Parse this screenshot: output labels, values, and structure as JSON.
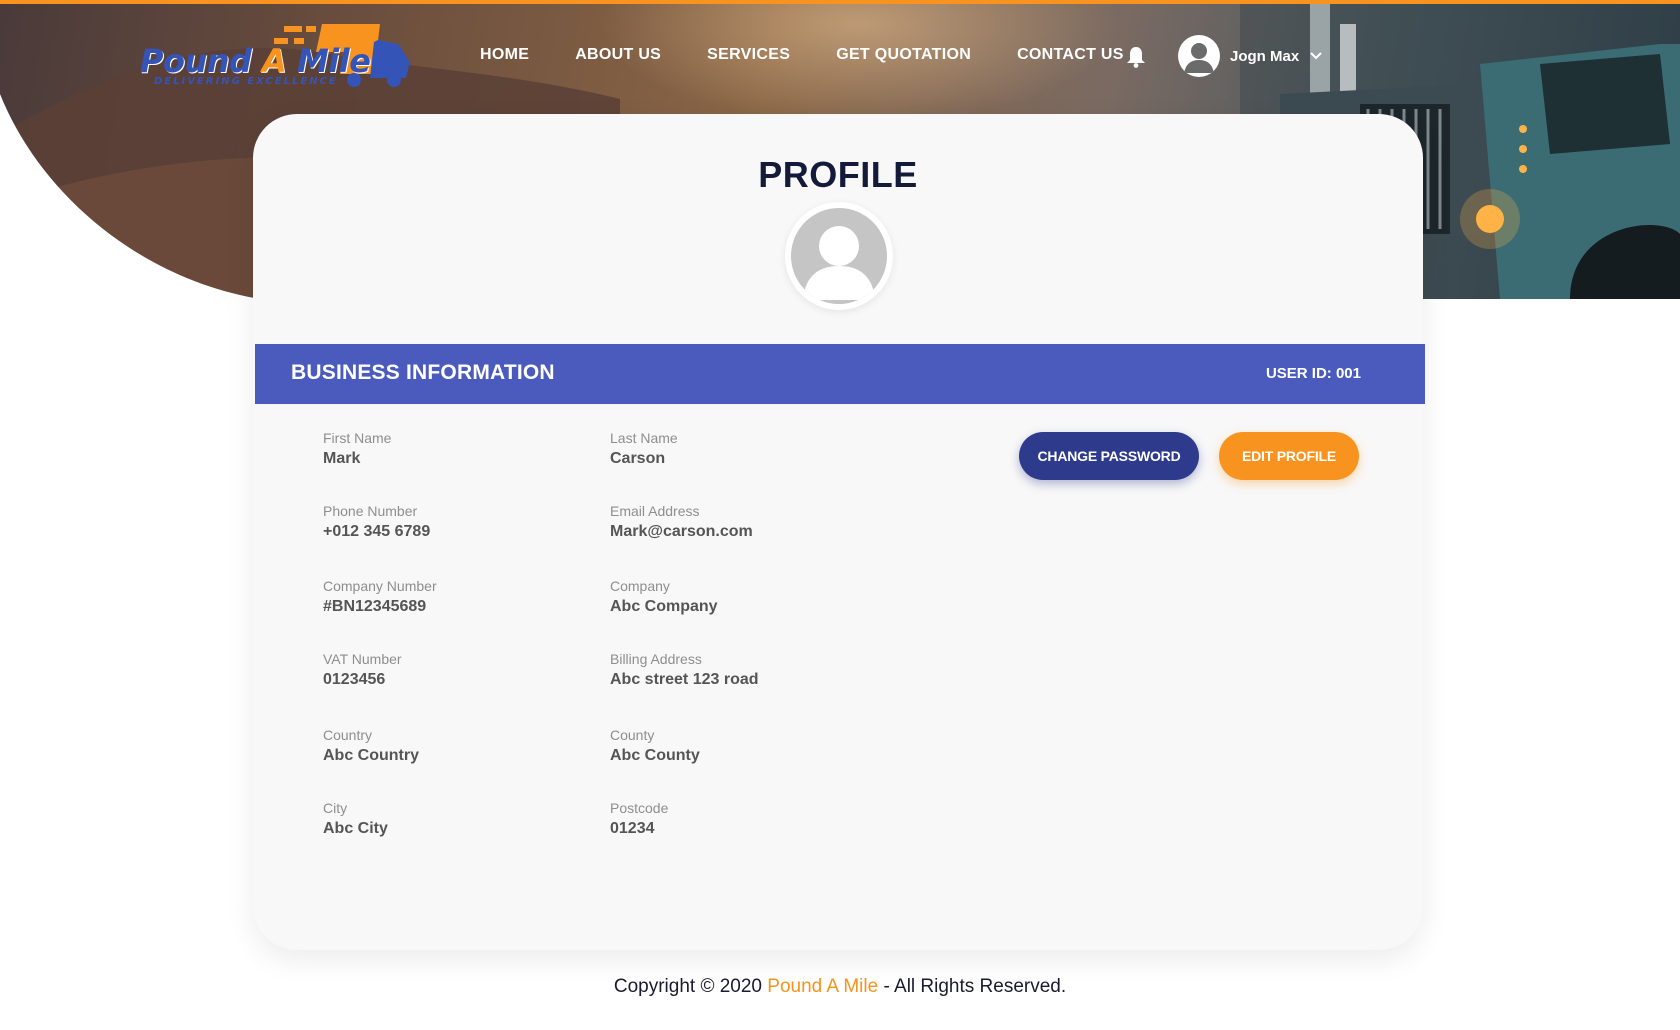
{
  "brand": {
    "logo_name": "Pound A Mile",
    "tagline": "DELIVERING EXCELLENCE",
    "colors": {
      "accent": "#f7931e",
      "primary": "#4a5bbd",
      "dark_blue": "#2e3a8c",
      "title": "#141b3a"
    }
  },
  "nav": {
    "items": [
      {
        "label": "HOME"
      },
      {
        "label": "ABOUT US"
      },
      {
        "label": "SERVICES"
      },
      {
        "label": "GET QUOTATION"
      },
      {
        "label": "CONTACT US"
      }
    ],
    "user_name": "Jogn Max",
    "icons": [
      "bell-icon",
      "user-avatar-icon",
      "chevron-down-icon"
    ]
  },
  "profile": {
    "title": "PROFILE",
    "section_title": "BUSINESS INFORMATION",
    "user_id": "USER ID: 001",
    "buttons": {
      "change_password": "CHANGE PASSWORD",
      "edit_profile": "EDIT PROFILE"
    },
    "fields": [
      {
        "label": "First Name",
        "value": "Mark"
      },
      {
        "label": "Last Name",
        "value": "Carson"
      },
      {
        "label": "Phone Number",
        "value": "+012 345 6789"
      },
      {
        "label": "Email Address",
        "value": "Mark@carson.com"
      },
      {
        "label": "Company Number",
        "value": "#BN12345689"
      },
      {
        "label": "Company",
        "value": "Abc Company"
      },
      {
        "label": "VAT Number",
        "value": "0123456"
      },
      {
        "label": "Billing Address",
        "value": "Abc street 123 road"
      },
      {
        "label": "Country",
        "value": "Abc Country"
      },
      {
        "label": "County",
        "value": "Abc County"
      },
      {
        "label": "City",
        "value": "Abc City"
      },
      {
        "label": "Postcode",
        "value": "01234"
      }
    ]
  },
  "footer": {
    "prefix": "Copyright © 2020",
    "brand": "Pound A Mile",
    "suffix": "- All Rights Reserved."
  }
}
